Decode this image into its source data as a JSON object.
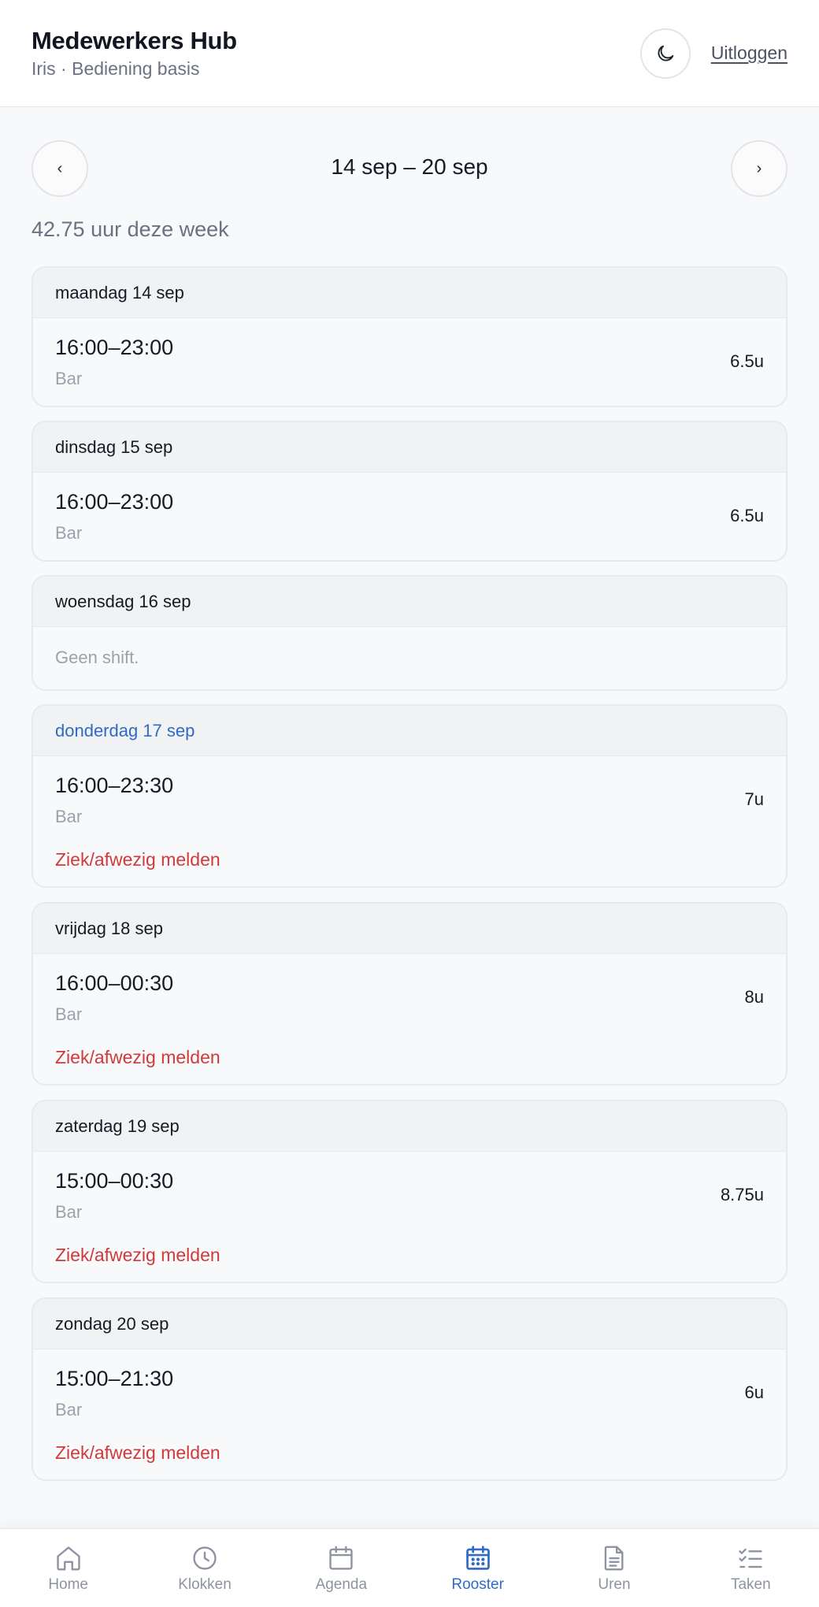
{
  "header": {
    "title": "Medewerkers Hub",
    "subtitle": "Iris · Bediening basis",
    "logout_label": "Uitloggen",
    "theme_icon": "moon-icon"
  },
  "week": {
    "prev_label": "‹",
    "next_label": "›",
    "range": "14 sep – 20 sep",
    "total": "42.75 uur deze week"
  },
  "days": [
    {
      "label": "maandag 14 sep",
      "time": "16:00–23:00",
      "role": "Bar",
      "hours": "6.5u"
    },
    {
      "label": "dinsdag 15 sep",
      "time": "16:00–23:00",
      "role": "Bar",
      "hours": "6.5u"
    },
    {
      "label": "woensdag 16 sep",
      "empty": "Geen shift."
    },
    {
      "label": "donderdag 17 sep",
      "time": "16:00–23:30",
      "role": "Bar",
      "hours": "7u",
      "action": "Ziek/afwezig melden"
    },
    {
      "label": "vrijdag 18 sep",
      "time": "16:00–00:30",
      "role": "Bar",
      "hours": "8u",
      "action": "Ziek/afwezig melden"
    },
    {
      "label": "zaterdag 19 sep",
      "time": "15:00–00:30",
      "role": "Bar",
      "hours": "8.75u",
      "action": "Ziek/afwezig melden"
    },
    {
      "label": "zondag 20 sep",
      "time": "15:00–21:30",
      "role": "Bar",
      "hours": "6u",
      "action": "Ziek/afwezig melden"
    }
  ],
  "tabs": [
    {
      "label": "Home",
      "icon": "home-icon"
    },
    {
      "label": "Klokken",
      "icon": "clock-icon"
    },
    {
      "label": "Agenda",
      "icon": "calendar-icon"
    },
    {
      "label": "Rooster",
      "icon": "schedule-icon",
      "active": true
    },
    {
      "label": "Uren",
      "icon": "document-icon"
    },
    {
      "label": "Taken",
      "icon": "checklist-icon"
    }
  ],
  "colors": {
    "accent": "#2f6ac8",
    "danger": "#cf3a3a",
    "muted": "#9ca1ab"
  }
}
